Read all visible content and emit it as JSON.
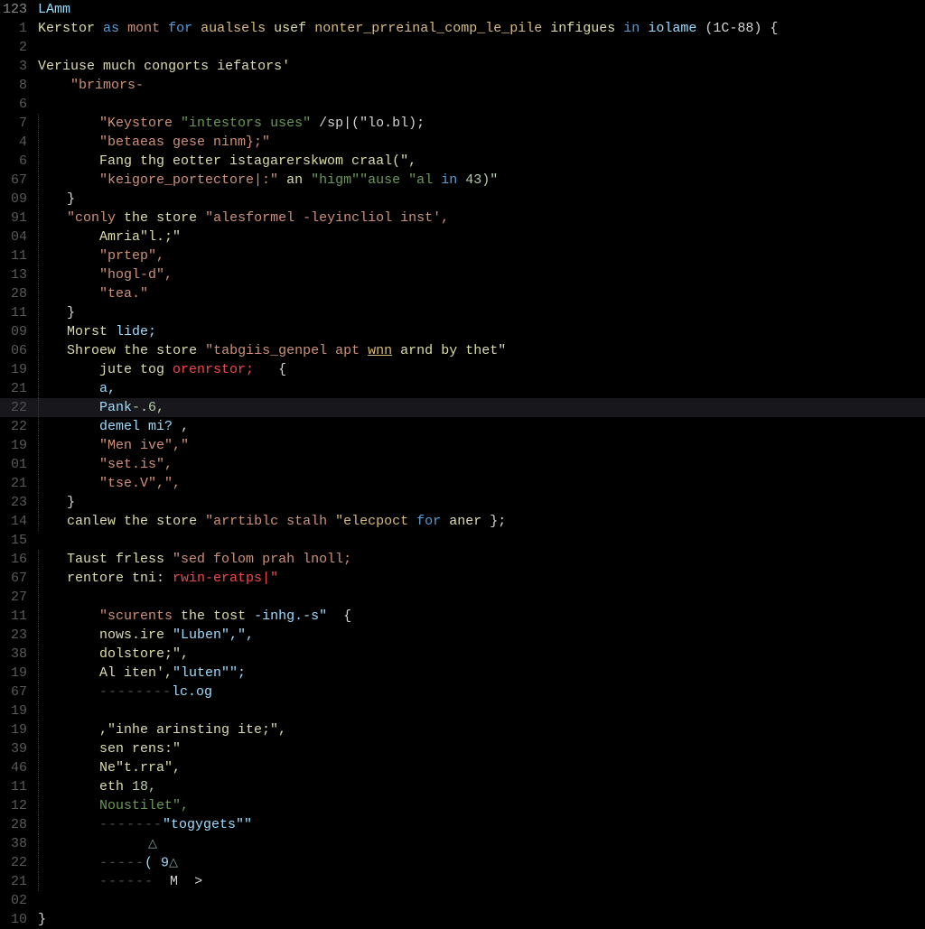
{
  "top": {
    "num": "123",
    "label": "LAmm"
  },
  "lines": [
    {
      "num": "1",
      "hl": false
    },
    {
      "num": "2",
      "hl": false
    },
    {
      "num": "3",
      "hl": false
    },
    {
      "num": "8",
      "hl": false
    },
    {
      "num": "6",
      "hl": false
    },
    {
      "num": "7",
      "hl": false
    },
    {
      "num": "4",
      "hl": false
    },
    {
      "num": "6",
      "hl": false
    },
    {
      "num": "67",
      "hl": false
    },
    {
      "num": "09",
      "hl": false
    },
    {
      "num": "91",
      "hl": false
    },
    {
      "num": "04",
      "hl": false
    },
    {
      "num": "11",
      "hl": false
    },
    {
      "num": "13",
      "hl": false
    },
    {
      "num": "28",
      "hl": false
    },
    {
      "num": "11",
      "hl": false
    },
    {
      "num": "09",
      "hl": false
    },
    {
      "num": "06",
      "hl": false
    },
    {
      "num": "19",
      "hl": false
    },
    {
      "num": "21",
      "hl": false
    },
    {
      "num": "22",
      "hl": true
    },
    {
      "num": "22",
      "hl": false
    },
    {
      "num": "19",
      "hl": false
    },
    {
      "num": "01",
      "hl": false
    },
    {
      "num": "21",
      "hl": false
    },
    {
      "num": "23",
      "hl": false
    },
    {
      "num": "14",
      "hl": false
    },
    {
      "num": "15",
      "hl": false
    },
    {
      "num": "16",
      "hl": false
    },
    {
      "num": "67",
      "hl": false
    },
    {
      "num": "27",
      "hl": false
    },
    {
      "num": "11",
      "hl": false
    },
    {
      "num": "23",
      "hl": false
    },
    {
      "num": "38",
      "hl": false
    },
    {
      "num": "19",
      "hl": false
    },
    {
      "num": "67",
      "hl": false
    },
    {
      "num": "19",
      "hl": false
    },
    {
      "num": "19",
      "hl": false
    },
    {
      "num": "39",
      "hl": false
    },
    {
      "num": "46",
      "hl": false
    },
    {
      "num": "11",
      "hl": false
    },
    {
      "num": "12",
      "hl": false
    },
    {
      "num": "28",
      "hl": false
    },
    {
      "num": "38",
      "hl": false
    },
    {
      "num": "22",
      "hl": false
    },
    {
      "num": "21",
      "hl": false
    },
    {
      "num": "02",
      "hl": false
    },
    {
      "num": "10",
      "hl": false
    }
  ],
  "l1": {
    "a": "Kerstor",
    "b": "as",
    "c": "mont",
    "d": "for",
    "e": "aualsels",
    "f": "usef",
    "g": "nonter_prreinal_comp_le_pile",
    "h": "infigues",
    "i": "in",
    "j": "iolame",
    "k": "(1C-88)",
    "brace": "{"
  },
  "l3": {
    "a": "Veriuse",
    "b": "much",
    "c": "congorts",
    "d": "iefators'"
  },
  "l4": {
    "a": "\"brimors-"
  },
  "l6": {
    "a": "\"Keystore",
    "b": "\"intestors uses\"",
    "c": "/sp|(\"lo.bl);"
  },
  "l7": {
    "a": "\"betaeas gese ninm};\""
  },
  "l8": {
    "a": "Fang thg eotter istagarerskwom craal(\","
  },
  "l9": {
    "a": "\"keigore_portectore|:\"",
    "b": "an",
    "c": "\"higm\"\"ause",
    "d": "\"al",
    "e": "in",
    "f": "43)\""
  },
  "l10": {
    "a": "}"
  },
  "l11": {
    "a": "\"conly",
    "b": "the",
    "c": "store",
    "d": "\"alesformel -leyincliol inst',"
  },
  "l12": {
    "a": "Amria\"l.;\""
  },
  "l13": {
    "a": "\"prtep\","
  },
  "l14": {
    "a": "\"hogl-d\","
  },
  "l15": {
    "a": "\"tea.\""
  },
  "l16": {
    "a": "}"
  },
  "l17": {
    "a": "Morst",
    "b": "lide;"
  },
  "l18": {
    "a": "Shroew",
    "b": "the",
    "c": "store",
    "d": "\"tabgiis_genpel apt",
    "e": "wnn",
    "f": "arnd",
    "g": "by",
    "h": "thet\""
  },
  "l19": {
    "a": "jute tog",
    "b": "orenrstor;",
    "c": "{"
  },
  "l20": {
    "a": "a,"
  },
  "l21": {
    "a": "Pank",
    "b": "-.6,"
  },
  "l22": {
    "a": "demel",
    "b": "mi?",
    "c": ","
  },
  "l23": {
    "a": "\"Men ive\",\""
  },
  "l24": {
    "a": "\"set.is\","
  },
  "l25": {
    "a": "\"tse.V\",\","
  },
  "l26": {
    "a": "}"
  },
  "l27": {
    "a": "canlew",
    "b": "the",
    "c": "store",
    "d": "\"arrtiblc stalh",
    "e": "\"elecpoct",
    "f": "for",
    "g": "aner",
    "h": "};"
  },
  "l29": {
    "a": "Taust frless",
    "b": "\"sed folom prah lnoll;"
  },
  "l30": {
    "a": "rentore tni:",
    "b": "rwin-eratps|\""
  },
  "l32": {
    "a": "\"scurents",
    "b": "the",
    "c": "tost",
    "d": "-inhg.-s\"",
    "e": "{"
  },
  "l33": {
    "a": "nows.ire",
    "b": "\"Luben\",\","
  },
  "l34": {
    "a": "dolstore;\","
  },
  "l35": {
    "a": "Al iten',",
    "b": "\"luten\"\";"
  },
  "l36": {
    "a": "--------",
    "b": "lc.og"
  },
  "l38": {
    "a": ",\"inhe arinsting ite;\","
  },
  "l39": {
    "a": "sen rens:\""
  },
  "l40": {
    "a": "Ne\"t.rra\","
  },
  "l41": {
    "a": "eth",
    "b": "18,"
  },
  "l42": {
    "a": "Noustilet\","
  },
  "l43": {
    "a": "-------",
    "b": "\"togygets\"\""
  },
  "l45a": {
    "a": "-----",
    "b": "( 9"
  },
  "l46b": {
    "a": "------",
    "b": "M",
    "c": ">"
  },
  "l48": {
    "a": "}"
  }
}
